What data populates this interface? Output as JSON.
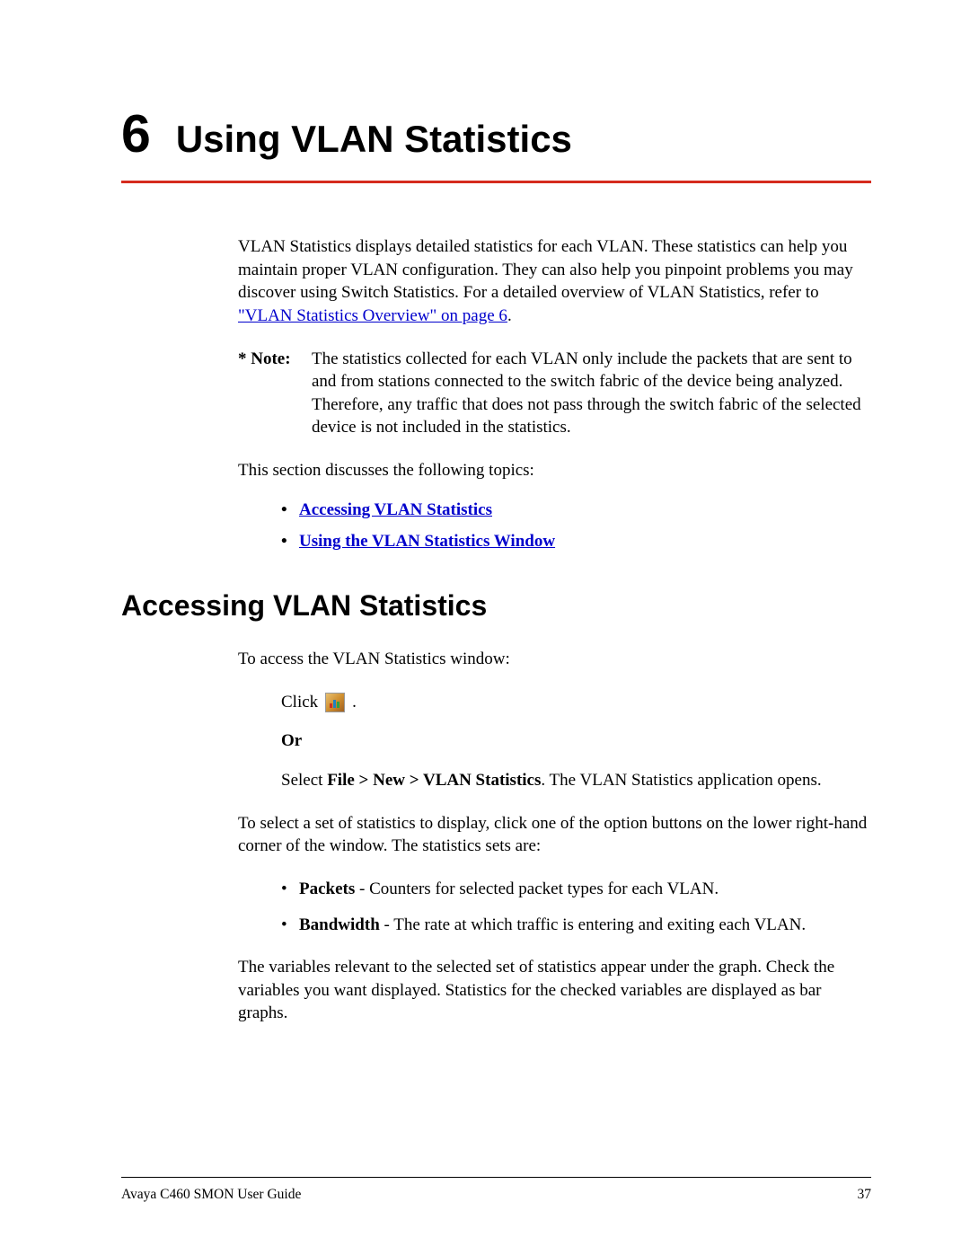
{
  "chapter": {
    "number": "6",
    "title": "Using VLAN Statistics"
  },
  "intro": {
    "text_before_link": "VLAN Statistics displays detailed statistics for each VLAN. These statistics can help you maintain proper VLAN configuration. They can also help you pinpoint problems you may discover using Switch Statistics. For a detailed overview of VLAN Statistics, refer to ",
    "link_text": "\"VLAN Statistics Overview\" on page 6",
    "text_after_link": "."
  },
  "note": {
    "label": "* Note:",
    "body": "The statistics collected for each VLAN only include the packets that are sent to and from stations connected to the switch fabric of the device being analyzed. Therefore, any traffic that does not pass through the switch fabric of the selected device is not included in the statistics."
  },
  "topics_lead": "This section discusses the following topics:",
  "toc": [
    "Accessing VLAN Statistics",
    "Using the VLAN Statistics Window"
  ],
  "section": {
    "heading": "Accessing VLAN Statistics",
    "lead": "To access the VLAN Statistics window:",
    "click_label": "Click",
    "click_period": ".",
    "or_label": "Or",
    "select_prefix": "Select ",
    "select_bold": "File > New > VLAN Statistics",
    "select_suffix": ". The VLAN Statistics application opens.",
    "para2": "To select a set of statistics to display, click one of the option buttons on the lower right-hand corner of the window. The statistics sets are:",
    "bullets": [
      {
        "bold": "Packets",
        "rest": " - Counters for selected packet types for each VLAN."
      },
      {
        "bold": "Bandwidth",
        "rest": " - The rate at which traffic is entering and exiting each VLAN."
      }
    ],
    "para3": "The variables relevant to the selected set of statistics appear under the graph. Check the variables you want displayed. Statistics for the checked variables are displayed as bar graphs."
  },
  "footer": {
    "left": "Avaya C460 SMON User Guide",
    "right": "37"
  }
}
